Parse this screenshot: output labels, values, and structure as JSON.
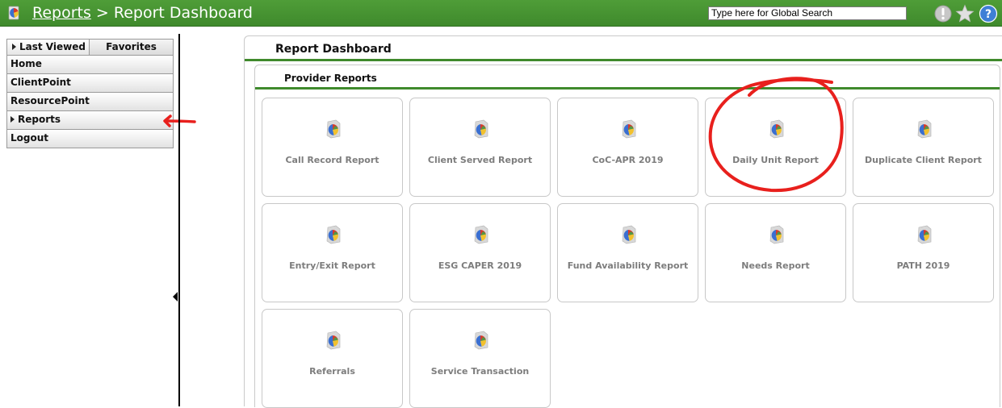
{
  "header": {
    "breadcrumb_link": "Reports",
    "breadcrumb_separator": " > ",
    "breadcrumb_current": "Report Dashboard",
    "search_placeholder": "Type here for Global Search",
    "accent_color": "#3f8a2c"
  },
  "nav": {
    "tabs": [
      {
        "label": "Last Viewed"
      },
      {
        "label": "Favorites"
      }
    ],
    "items": [
      {
        "label": "Home"
      },
      {
        "label": "ClientPoint"
      },
      {
        "label": "ResourcePoint"
      },
      {
        "label": "Reports"
      },
      {
        "label": "Logout"
      }
    ]
  },
  "main": {
    "title": "Report Dashboard",
    "section_title": "Provider Reports",
    "reports": [
      {
        "label": "Call Record Report"
      },
      {
        "label": "Client Served Report"
      },
      {
        "label": "CoC-APR 2019"
      },
      {
        "label": "Daily Unit Report"
      },
      {
        "label": "Duplicate Client Report"
      },
      {
        "label": "Entry/Exit Report"
      },
      {
        "label": "ESG CAPER 2019"
      },
      {
        "label": "Fund Availability Report"
      },
      {
        "label": "Needs Report"
      },
      {
        "label": "PATH 2019"
      },
      {
        "label": "Referrals"
      },
      {
        "label": "Service Transaction"
      }
    ]
  },
  "icons": {
    "logo": "report-logo-icon",
    "alert": "alert-icon",
    "star": "star-icon",
    "help": "help-icon",
    "report": "report-pie-icon"
  }
}
